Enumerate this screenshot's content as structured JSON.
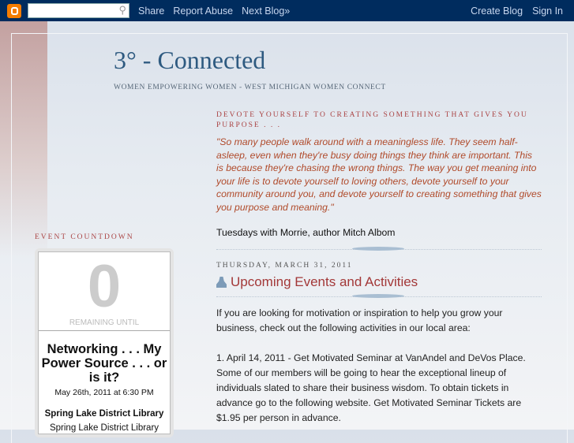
{
  "navbar": {
    "search_placeholder": "",
    "links": [
      "Share",
      "Report Abuse",
      "Next Blog»"
    ],
    "right": [
      "Create Blog",
      "Sign In"
    ]
  },
  "header": {
    "title": "3° - Connected",
    "description": "WOMEN EMPOWERING WOMEN - WEST MICHIGAN WOMEN CONNECT"
  },
  "quote_section": {
    "heading": "DEVOTE YOURSELF TO CREATING SOMETHING THAT GIVES YOU PURPOSE . . .",
    "quote": "\"So many people walk around with a meaningless life. They seem half-asleep, even when they're busy doing things they think are important. This is because they're chasing the wrong things. The way you get meaning into your life is to devote yourself to loving others, devote yourself to your community around you, and devote yourself to creating something that gives you purpose and meaning.\"",
    "attribution": "Tuesdays with Morrie, author Mitch Albom"
  },
  "post": {
    "date": "THURSDAY, MARCH 31, 2011",
    "title": "Upcoming Events and Activities",
    "paragraphs": [
      "If you are looking for motivation or inspiration to help you grow your business, check out the following activities in our local area:",
      "1. April 14, 2011 - Get Motivated Seminar at VanAndel and DeVos Place. Some of our members will be going to hear the exceptional lineup of individuals slated to share their business wisdom. To obtain tickets in advance go to the following website. Get Motivated Seminar Tickets are $1.95 per person in advance."
    ]
  },
  "sidebar": {
    "heading": "EVENT COUNTDOWN",
    "count": "0",
    "remaining": "REMAINING UNTIL",
    "event": "Networking . . . My Power Source . . . or is it?",
    "event_date": "May 26th, 2011 at 6:30 PM",
    "location": "Spring Lake District Library",
    "location_detail": "Spring Lake District Library"
  }
}
